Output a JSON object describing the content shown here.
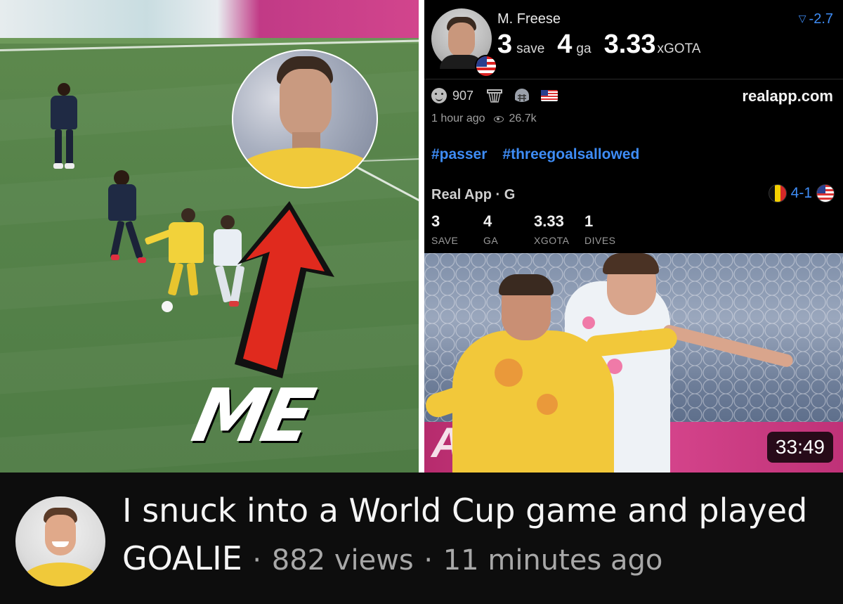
{
  "left_panel": {
    "overlay_text": "ME",
    "arrow_color": "#e02a1e"
  },
  "card": {
    "player_name": "M. Freese",
    "delta": "-2.7",
    "headline": {
      "saves_value": "3",
      "saves_unit": "save",
      "ga_value": "4",
      "ga_unit": "ga",
      "xgota_value": "3.33",
      "xgota_unit": "xGOTA"
    },
    "reaction_count": "907",
    "site": "realapp.com",
    "posted": "1 hour ago",
    "views": "26.7k",
    "tags": [
      "#passer",
      "#threegoalsallowed"
    ],
    "app_label": "Real App · G",
    "score": "4-1",
    "stats": [
      {
        "value": "3",
        "label": "SAVE"
      },
      {
        "value": "4",
        "label": "GA"
      },
      {
        "value": "3.33",
        "label": "XGOTA"
      },
      {
        "value": "1",
        "label": "DIVES"
      }
    ],
    "photo_ad_text": "AVA",
    "duration": "33:49",
    "accent_color": "#3e8cf5"
  },
  "video": {
    "title": "I snuck into a World Cup game and played GOALIE",
    "separator": "·",
    "views": "882 views",
    "age": "11 minutes ago"
  }
}
